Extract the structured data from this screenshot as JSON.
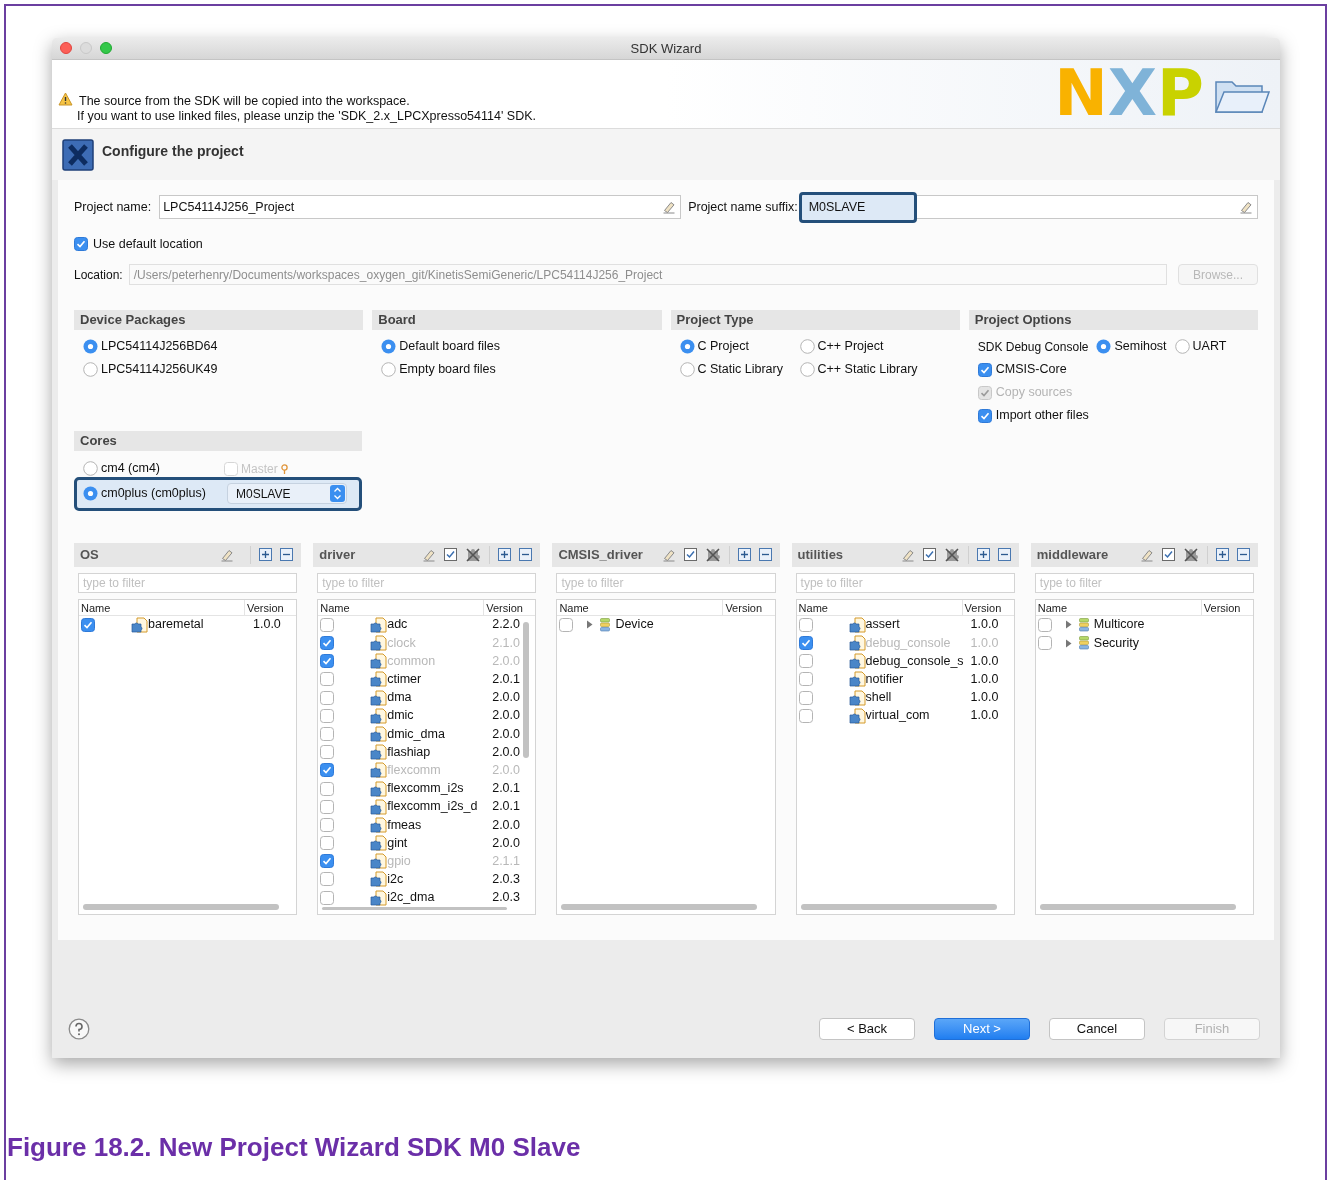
{
  "window": {
    "title": "SDK Wizard"
  },
  "message": {
    "lines": [
      "The source from the SDK will be copied into the workspace.",
      "If you want to use linked files, please unzip the 'SDK_2.x_LPCXpresso54114' SDK."
    ]
  },
  "logo": {
    "text": "NXP"
  },
  "page_header": {
    "title": "Configure the project"
  },
  "project_name": {
    "label": "Project name:",
    "value": "LPC54114J256_Project"
  },
  "project_name_suffix": {
    "label": "Project name suffix:",
    "value": "M0SLAVE",
    "highlighted": true
  },
  "use_default_location": {
    "label": "Use default location",
    "checked": true
  },
  "location": {
    "label": "Location:",
    "value": "/Users/peterhenry/Documents/workspaces_oxygen_git/KinetisSemiGeneric/LPC54114J256_Project",
    "disabled": true
  },
  "browse_button": {
    "label": "Browse...",
    "disabled": true
  },
  "groups": [
    {
      "title": "Device Packages",
      "two_columns": false,
      "items": [
        {
          "kind": "radio",
          "label": "LPC54114J256BD64",
          "selected": true
        },
        {
          "kind": "radio",
          "label": "LPC54114J256UK49",
          "selected": false
        }
      ]
    },
    {
      "title": "Board",
      "two_columns": false,
      "items": [
        {
          "kind": "radio",
          "label": "Default board files",
          "selected": true
        },
        {
          "kind": "radio",
          "label": "Empty board files",
          "selected": false
        }
      ]
    },
    {
      "title": "Project Type",
      "two_columns": true,
      "items": [
        {
          "kind": "radio",
          "label": "C Project",
          "selected": true
        },
        {
          "kind": "radio",
          "label": "C++ Project",
          "selected": false
        },
        {
          "kind": "radio",
          "label": "C Static Library",
          "selected": false
        },
        {
          "kind": "radio",
          "label": "C++ Static Library",
          "selected": false
        }
      ]
    },
    {
      "title": "Project Options",
      "two_columns": false,
      "items": [
        {
          "kind": "radio_row",
          "label": "SDK Debug Console",
          "options": [
            {
              "label": "Semihost",
              "selected": true
            },
            {
              "label": "UART",
              "selected": false
            }
          ]
        },
        {
          "kind": "checkbox",
          "label": "CMSIS-Core",
          "checked": true,
          "disabled": false
        },
        {
          "kind": "checkbox",
          "label": "Copy sources",
          "checked": true,
          "disabled": true
        },
        {
          "kind": "checkbox",
          "label": "Import other files",
          "checked": true,
          "disabled": false
        }
      ]
    }
  ],
  "cores": {
    "title": "Cores",
    "items": [
      {
        "label": "cm4 (cm4)",
        "selected": false,
        "highlighted": false,
        "master": {
          "label": "Master",
          "checked": false,
          "disabled": true
        }
      },
      {
        "label": "cm0plus (cm0plus)",
        "selected": true,
        "highlighted": true,
        "role": "M0SLAVE"
      }
    ]
  },
  "panels": [
    {
      "title": "OS",
      "bulk_select_tools": false,
      "filter_placeholder": "type to filter",
      "columns": [
        "Name",
        "Version"
      ],
      "vertical_scrollbar": false,
      "rows": [
        {
          "kind": "component",
          "checked": true,
          "disabled": false,
          "name": "baremetal",
          "version": "1.0.0"
        }
      ]
    },
    {
      "title": "driver",
      "bulk_select_tools": true,
      "filter_placeholder": "type to filter",
      "columns": [
        "Name",
        "Version"
      ],
      "vertical_scrollbar": true,
      "rows": [
        {
          "kind": "component",
          "checked": false,
          "disabled": false,
          "name": "adc",
          "version": "2.2.0"
        },
        {
          "kind": "component",
          "checked": true,
          "disabled": true,
          "name": "clock",
          "version": "2.1.0"
        },
        {
          "kind": "component",
          "checked": true,
          "disabled": true,
          "name": "common",
          "version": "2.0.0"
        },
        {
          "kind": "component",
          "checked": false,
          "disabled": false,
          "name": "ctimer",
          "version": "2.0.1"
        },
        {
          "kind": "component",
          "checked": false,
          "disabled": false,
          "name": "dma",
          "version": "2.0.0"
        },
        {
          "kind": "component",
          "checked": false,
          "disabled": false,
          "name": "dmic",
          "version": "2.0.0"
        },
        {
          "kind": "component",
          "checked": false,
          "disabled": false,
          "name": "dmic_dma",
          "version": "2.0.0"
        },
        {
          "kind": "component",
          "checked": false,
          "disabled": false,
          "name": "flashiap",
          "version": "2.0.0"
        },
        {
          "kind": "component",
          "checked": true,
          "disabled": true,
          "name": "flexcomm",
          "version": "2.0.0"
        },
        {
          "kind": "component",
          "checked": false,
          "disabled": false,
          "name": "flexcomm_i2s",
          "version": "2.0.1"
        },
        {
          "kind": "component",
          "checked": false,
          "disabled": false,
          "name": "flexcomm_i2s_d",
          "version": "2.0.1"
        },
        {
          "kind": "component",
          "checked": false,
          "disabled": false,
          "name": "fmeas",
          "version": "2.0.0"
        },
        {
          "kind": "component",
          "checked": false,
          "disabled": false,
          "name": "gint",
          "version": "2.0.0"
        },
        {
          "kind": "component",
          "checked": true,
          "disabled": true,
          "name": "gpio",
          "version": "2.1.1"
        },
        {
          "kind": "component",
          "checked": false,
          "disabled": false,
          "name": "i2c",
          "version": "2.0.3"
        },
        {
          "kind": "component",
          "checked": false,
          "disabled": false,
          "name": "i2c_dma",
          "version": "2.0.3"
        }
      ]
    },
    {
      "title": "CMSIS_driver",
      "bulk_select_tools": true,
      "filter_placeholder": "type to filter",
      "columns": [
        "Name",
        "Version"
      ],
      "vertical_scrollbar": false,
      "rows": [
        {
          "kind": "group",
          "checked": false,
          "expanded": false,
          "name": "Device"
        }
      ]
    },
    {
      "title": "utilities",
      "bulk_select_tools": true,
      "filter_placeholder": "type to filter",
      "columns": [
        "Name",
        "Version"
      ],
      "vertical_scrollbar": false,
      "rows": [
        {
          "kind": "component",
          "checked": false,
          "disabled": false,
          "name": "assert",
          "version": "1.0.0"
        },
        {
          "kind": "component",
          "checked": true,
          "disabled": true,
          "name": "debug_console",
          "version": "1.0.0"
        },
        {
          "kind": "component",
          "checked": false,
          "disabled": false,
          "name": "debug_console_s",
          "version": "1.0.0"
        },
        {
          "kind": "component",
          "checked": false,
          "disabled": false,
          "name": "notifier",
          "version": "1.0.0"
        },
        {
          "kind": "component",
          "checked": false,
          "disabled": false,
          "name": "shell",
          "version": "1.0.0"
        },
        {
          "kind": "component",
          "checked": false,
          "disabled": false,
          "name": "virtual_com",
          "version": "1.0.0"
        }
      ]
    },
    {
      "title": "middleware",
      "bulk_select_tools": true,
      "filter_placeholder": "type to filter",
      "columns": [
        "Name",
        "Version"
      ],
      "vertical_scrollbar": false,
      "rows": [
        {
          "kind": "group",
          "checked": false,
          "expanded": false,
          "name": "Multicore"
        },
        {
          "kind": "group",
          "checked": false,
          "expanded": false,
          "name": "Security"
        }
      ]
    }
  ],
  "buttons": [
    {
      "label": "< Back",
      "kind": "default",
      "disabled": false
    },
    {
      "label": "Next >",
      "kind": "primary",
      "disabled": false
    },
    {
      "label": "Cancel",
      "kind": "default",
      "disabled": false
    },
    {
      "label": "Finish",
      "kind": "default",
      "disabled": true
    }
  ],
  "caption": "Figure 18.2. New Project Wizard SDK M0 Slave"
}
